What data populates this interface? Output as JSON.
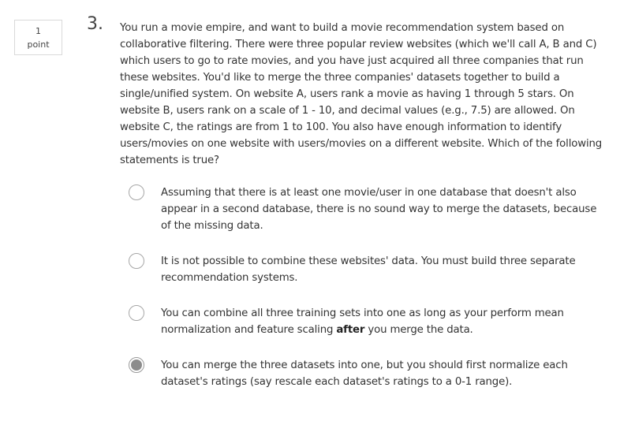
{
  "points": {
    "value": "1",
    "label": "point"
  },
  "question": {
    "number": "3.",
    "text": "You run a movie empire, and want to build a movie recommendation system based on collaborative filtering. There were three popular review websites (which we'll call A, B and C) which users to go to rate movies, and you have just acquired all three companies that run these websites. You'd like to merge the three companies' datasets together to build a single/unified system. On website A, users rank a movie as having 1 through 5 stars. On website B, users rank on a scale of 1 - 10, and decimal values (e.g., 7.5) are allowed. On website C, the ratings are from 1 to 100. You also have enough information to identify users/movies on one website with users/movies on a different website. Which of the following statements is true?"
  },
  "options": [
    {
      "text": "Assuming that there is at least one movie/user in one database that doesn't also appear in a second database, there is no sound way to merge the datasets, because of the missing data.",
      "selected": false
    },
    {
      "text": "It is not possible to combine these websites' data. You must build three separate recommendation systems.",
      "selected": false
    },
    {
      "text_before": "You can combine all three training sets into one as long as your perform mean normalization and feature scaling ",
      "text_bold": "after",
      "text_after": " you merge the data.",
      "selected": false
    },
    {
      "text": "You can merge the three datasets into one, but you should first normalize each dataset's ratings (say rescale each dataset's ratings to a 0-1 range).",
      "selected": true
    }
  ]
}
